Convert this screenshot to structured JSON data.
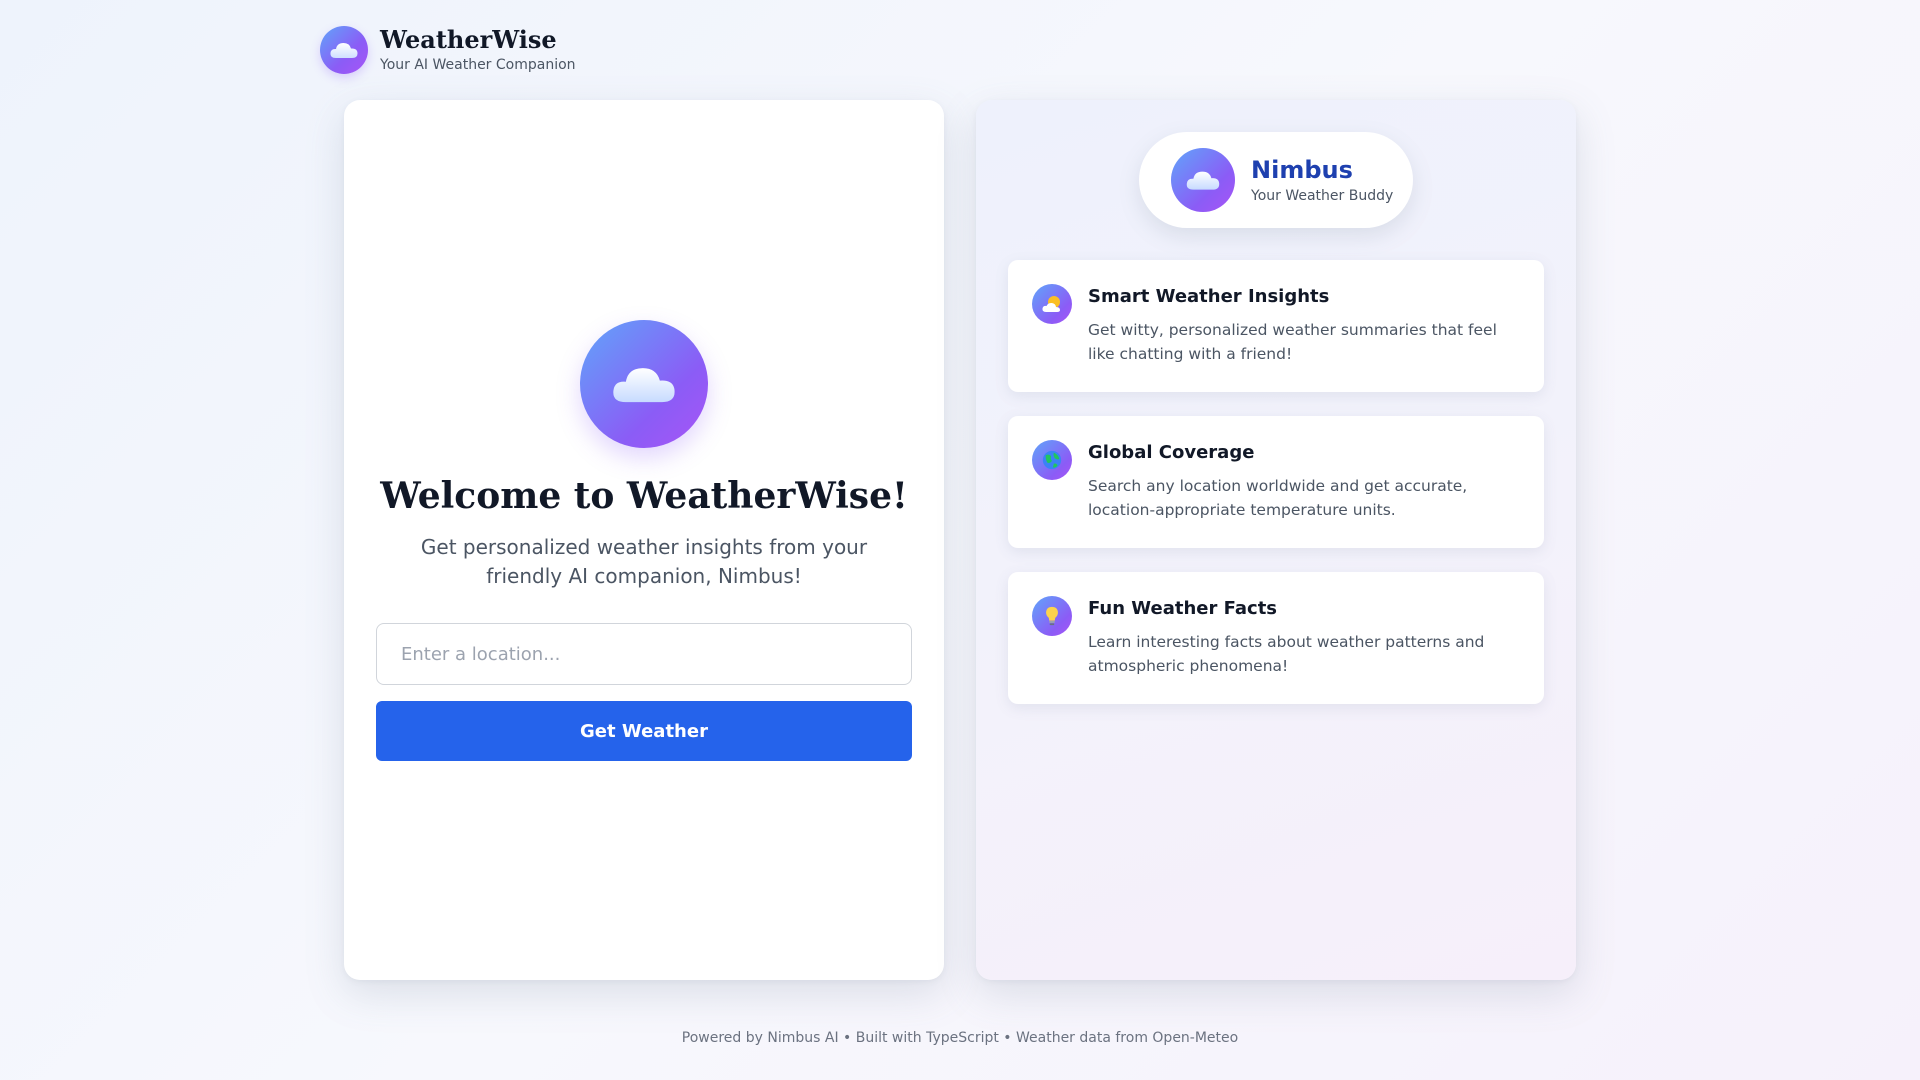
{
  "header": {
    "logo_icon": "cloud-icon",
    "title": "WeatherWise",
    "subtitle": "Your AI Weather Companion"
  },
  "main": {
    "hero_icon": "cloud-icon",
    "title": "Welcome to WeatherWise!",
    "subtitle": "Get personalized weather insights from your friendly AI companion, Nimbus!",
    "search": {
      "placeholder": "Enter a location...",
      "value": ""
    },
    "button_label": "Get Weather"
  },
  "assistant": {
    "avatar_icon": "cloud-icon",
    "name": "Nimbus",
    "tagline": "Your Weather Buddy"
  },
  "features": [
    {
      "icon": "sun-behind-cloud-icon",
      "title": "Smart Weather Insights",
      "description": "Get witty, personalized weather summaries that feel like chatting with a friend!"
    },
    {
      "icon": "globe-icon",
      "title": "Global Coverage",
      "description": "Search any location worldwide and get accurate, location-appropriate temperature units."
    },
    {
      "icon": "lightbulb-icon",
      "title": "Fun Weather Facts",
      "description": "Learn interesting facts about weather patterns and atmospheric phenomena!"
    }
  ],
  "footer": {
    "text": "Powered by Nimbus AI • Built with TypeScript • Weather data from Open-Meteo"
  },
  "colors": {
    "primary": "#2563eb",
    "accent_name": "#1e40af",
    "gradient_start": "#60a5fa",
    "gradient_end": "#a855f7"
  }
}
